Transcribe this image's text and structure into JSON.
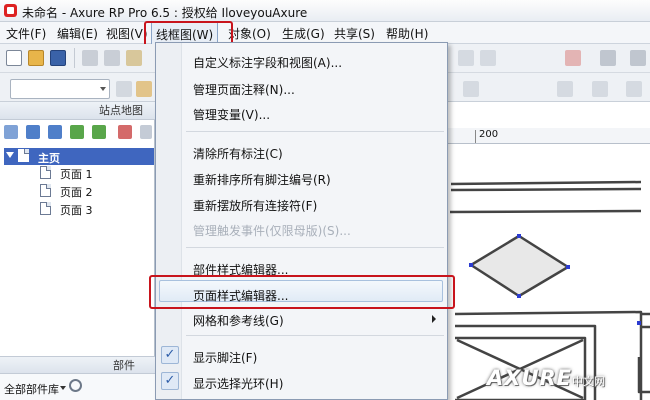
{
  "window": {
    "title": "未命名 - Axure RP Pro 6.5 : 授权给 IloveyouAxure"
  },
  "menubar": {
    "items": [
      "文件(F)",
      "编辑(E)",
      "视图(V)",
      "线框图(W)",
      "对象(O)",
      "生成(G)",
      "共享(S)",
      "帮助(H)"
    ],
    "active_index": 3
  },
  "sitemap": {
    "header": "站点地图",
    "root": "主页",
    "pages": [
      "页面 1",
      "页面 2",
      "页面 3"
    ]
  },
  "widgets": {
    "header": "部件",
    "library": "全部部件库"
  },
  "canvas": {
    "ruler_label": "200"
  },
  "wireframe_menu": {
    "items": [
      {
        "label": "自定义标注字段和视图(A)..."
      },
      {
        "label": "管理页面注释(N)..."
      },
      {
        "label": "管理变量(V)..."
      },
      {
        "label": "清除所有标注(C)"
      },
      {
        "label": "重新排序所有脚注编号(R)"
      },
      {
        "label": "重新摆放所有连接符(F)"
      },
      {
        "label": "管理触发事件(仅限母版)(S)..."
      },
      {
        "label": "部件样式编辑器..."
      },
      {
        "label": "页面样式编辑器..."
      },
      {
        "label": "网格和参考线(G)"
      },
      {
        "label": "显示脚注(F)"
      },
      {
        "label": "显示选择光环(H)"
      }
    ]
  },
  "watermark": {
    "text": "AXURE",
    "suffix": "中文网"
  },
  "colors": {
    "highlight_red": "#c8141c",
    "selection_blue": "#3f66bf",
    "handle_blue": "#2b3bd0"
  }
}
